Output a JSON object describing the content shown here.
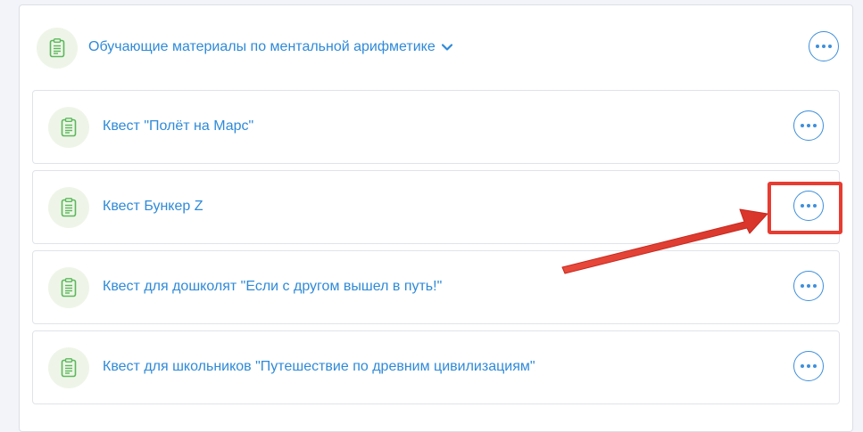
{
  "folder": {
    "title": "Обучающие материалы по ментальной арифметике",
    "icon": "clipboard-icon",
    "expand_icon": "chevron-down-icon",
    "more_icon": "more-horizontal-icon"
  },
  "items": [
    {
      "title": "Квест \"Полёт на Марс\"",
      "icon": "clipboard-icon"
    },
    {
      "title": "Квест Бункер Z",
      "icon": "clipboard-icon"
    },
    {
      "title": "Квест для дошколят \"Если с другом вышел в путь!\"",
      "icon": "clipboard-icon"
    },
    {
      "title": "Квест для школьников \"Путешествие по древним цивилизациям\"",
      "icon": "clipboard-icon"
    }
  ],
  "annotation": {
    "highlight_color": "#e63c32",
    "highlighted_item": "Квест Бункер Z"
  },
  "colors": {
    "accent": "#2f8ad8",
    "icon_bg": "#eef5e8",
    "icon_stroke": "#5cb85c",
    "background": "#f3f3fa"
  }
}
